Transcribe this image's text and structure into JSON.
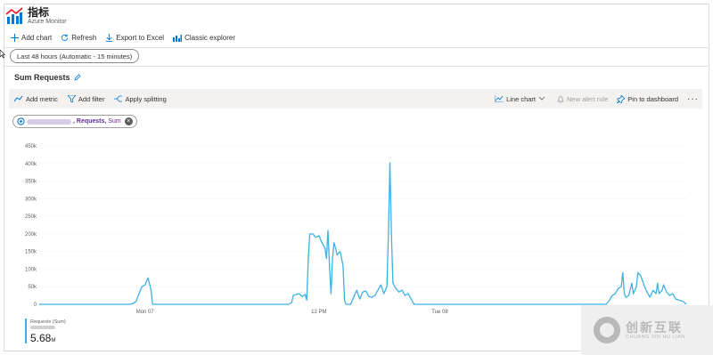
{
  "header": {
    "title": "指标",
    "subtitle": "Azure Monitor"
  },
  "toolbar": {
    "add_chart": "Add chart",
    "refresh": "Refresh",
    "export": "Export to Excel",
    "classic": "Classic explorer"
  },
  "time_range": "Last 48 hours (Automatic - 15 minutes)",
  "chart": {
    "title": "Sum Requests",
    "tools": {
      "add_metric": "Add metric",
      "add_filter": "Add filter",
      "apply_splitting": "Apply splitting",
      "line_chart": "Line chart",
      "new_alert_rule": "New alert rule",
      "pin": "Pin to dashboard",
      "more": "···"
    },
    "metric_pill": {
      "name": ", Requests,",
      "agg": "Sum"
    },
    "legend": {
      "name": "Requests (Sum)",
      "value": "5.68",
      "unit": "M"
    }
  },
  "colors": {
    "series": "#3bb1e5",
    "accent": "#0078d4",
    "grid": "#edebe9"
  },
  "watermark": {
    "zh": "创新互联",
    "en": "CHUANG XIN HU LIAN"
  },
  "chart_data": {
    "type": "line",
    "y_ticks": [
      "0",
      "50k",
      "100k",
      "150k",
      "200k",
      "250k",
      "300k",
      "350k",
      "400k",
      "450k"
    ],
    "ylim": [
      0,
      450000
    ],
    "x_ticks": [
      "Mon 07",
      "12 PM",
      "Tue 08"
    ],
    "series": [
      {
        "name": "Requests (Sum)",
        "points": [
          [
            0,
            0
          ],
          [
            20,
            0
          ],
          [
            40,
            0
          ],
          [
            55,
            0
          ],
          [
            60,
            0
          ],
          [
            62,
            2000
          ],
          [
            64,
            8000
          ],
          [
            66,
            30000
          ],
          [
            68,
            50000
          ],
          [
            70,
            55000
          ],
          [
            72,
            75000
          ],
          [
            74,
            40000
          ],
          [
            75,
            0
          ],
          [
            85,
            0
          ],
          [
            100,
            0
          ],
          [
            120,
            0
          ],
          [
            140,
            0
          ],
          [
            160,
            0
          ],
          [
            165,
            0
          ],
          [
            167,
            5000
          ],
          [
            168,
            25000
          ],
          [
            170,
            28000
          ],
          [
            172,
            30000
          ],
          [
            174,
            22000
          ],
          [
            176,
            28000
          ],
          [
            177,
            12000
          ],
          [
            178,
            130000
          ],
          [
            179,
            200000
          ],
          [
            181,
            200000
          ],
          [
            183,
            190000
          ],
          [
            185,
            195000
          ],
          [
            187,
            175000
          ],
          [
            189,
            160000
          ],
          [
            190,
            130000
          ],
          [
            191,
            210000
          ],
          [
            192,
            110000
          ],
          [
            193,
            30000
          ],
          [
            194,
            130000
          ],
          [
            195,
            175000
          ],
          [
            196,
            160000
          ],
          [
            197,
            140000
          ],
          [
            198,
            145000
          ],
          [
            199,
            150000
          ],
          [
            200,
            130000
          ],
          [
            201,
            110000
          ],
          [
            202,
            10000
          ],
          [
            203,
            0
          ],
          [
            206,
            0
          ],
          [
            208,
            20000
          ],
          [
            210,
            40000
          ],
          [
            212,
            15000
          ],
          [
            214,
            35000
          ],
          [
            216,
            38000
          ],
          [
            218,
            22000
          ],
          [
            220,
            20000
          ],
          [
            222,
            25000
          ],
          [
            224,
            40000
          ],
          [
            226,
            55000
          ],
          [
            228,
            30000
          ],
          [
            230,
            50000
          ],
          [
            231,
            200000
          ],
          [
            232,
            402000
          ],
          [
            233,
            200000
          ],
          [
            234,
            60000
          ],
          [
            236,
            45000
          ],
          [
            238,
            35000
          ],
          [
            240,
            40000
          ],
          [
            242,
            25000
          ],
          [
            244,
            30000
          ],
          [
            246,
            15000
          ],
          [
            248,
            0
          ],
          [
            270,
            0
          ],
          [
            300,
            0
          ],
          [
            330,
            0
          ],
          [
            360,
            0
          ],
          [
            375,
            0
          ],
          [
            377,
            10000
          ],
          [
            379,
            25000
          ],
          [
            381,
            30000
          ],
          [
            383,
            45000
          ],
          [
            385,
            50000
          ],
          [
            386,
            90000
          ],
          [
            387,
            30000
          ],
          [
            388,
            20000
          ],
          [
            390,
            25000
          ],
          [
            392,
            60000
          ],
          [
            393,
            30000
          ],
          [
            394,
            40000
          ],
          [
            395,
            50000
          ],
          [
            396,
            90000
          ],
          [
            398,
            80000
          ],
          [
            400,
            55000
          ],
          [
            402,
            35000
          ],
          [
            404,
            20000
          ],
          [
            406,
            40000
          ],
          [
            408,
            30000
          ],
          [
            409,
            60000
          ],
          [
            410,
            30000
          ],
          [
            412,
            40000
          ],
          [
            413,
            55000
          ],
          [
            415,
            35000
          ],
          [
            417,
            25000
          ],
          [
            419,
            30000
          ],
          [
            421,
            15000
          ],
          [
            423,
            12000
          ],
          [
            426,
            8000
          ],
          [
            428,
            0
          ]
        ]
      }
    ]
  }
}
